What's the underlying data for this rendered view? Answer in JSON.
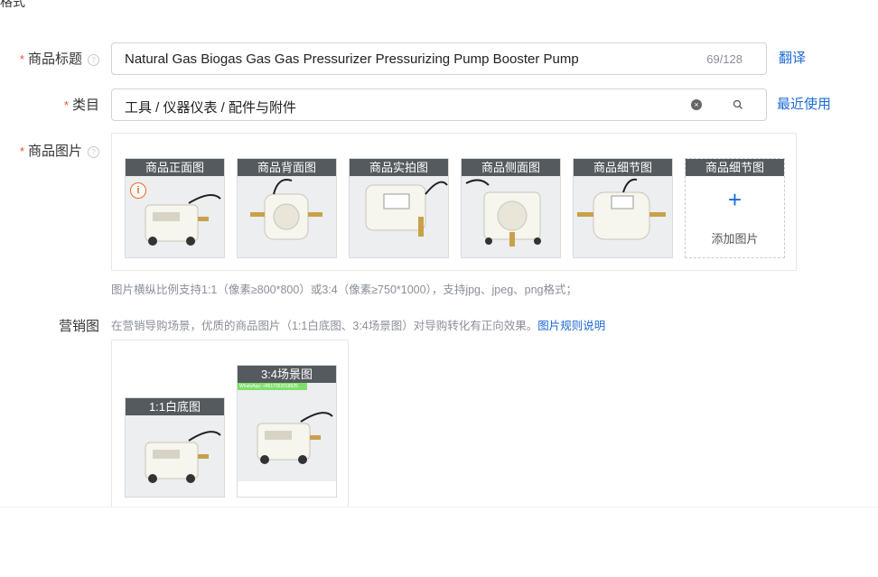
{
  "top_fragment": "格式",
  "title_field": {
    "label": "商品标题",
    "value": "Natural Gas Biogas Gas Gas Pressurizer Pressurizing Pump Booster Pump",
    "counter": "69/128",
    "action": "翻译"
  },
  "category_field": {
    "label": "类目",
    "value": "工具 / 仪器仪表 / 配件与附件",
    "action": "最近使用"
  },
  "images_field": {
    "label": "商品图片",
    "thumbnails": [
      {
        "caption": "商品正面图",
        "icon": "warning-icon"
      },
      {
        "caption": "商品背面图"
      },
      {
        "caption": "商品实拍图"
      },
      {
        "caption": "商品侧面图"
      },
      {
        "caption": "商品细节图"
      }
    ],
    "add_slot": {
      "caption": "商品细节图",
      "plus": "+",
      "label": "添加图片"
    },
    "hint": "图片横纵比例支持1:1（像素≥800*800）或3:4（像素≥750*1000），支持jpg、jpeg、png格式；"
  },
  "marketing_field": {
    "label": "营销图",
    "hint": "在营销导购场景，优质的商品图片（1:1白底图、3:4场景图）对导购转化有正向效果。",
    "hint_link": "图片规则说明",
    "images": [
      {
        "caption": "1:1白底图"
      },
      {
        "caption": "3:4场景图",
        "badge": "WhatsApp: +8617352018625"
      }
    ]
  },
  "colors": {
    "accent": "#1f6bd6",
    "required": "#e8542e",
    "warning": "#f06a24"
  }
}
